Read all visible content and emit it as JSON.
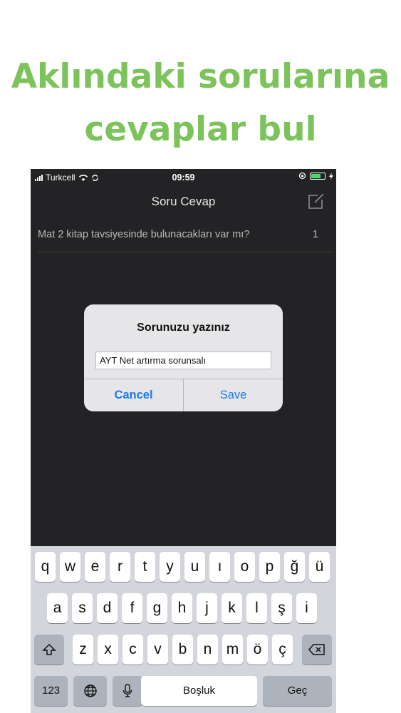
{
  "headline": {
    "line1": "Aklındaki sorularına",
    "line2": "cevaplar bul"
  },
  "status": {
    "carrier": "Turkcell",
    "time": "09:59"
  },
  "nav": {
    "title": "Soru Cevap",
    "compose_icon": "compose-icon"
  },
  "questions": [
    {
      "text": "Mat 2 kitap tavsiyesinde bulunacakları var mı?",
      "count": "1"
    }
  ],
  "dialog": {
    "title": "Sorunuzu yazınız",
    "input_value": "AYT Net artırma sorunsalı",
    "cancel": "Cancel",
    "save": "Save"
  },
  "keyboard": {
    "row1": [
      "q",
      "w",
      "e",
      "r",
      "t",
      "y",
      "u",
      "ı",
      "o",
      "p",
      "ğ",
      "ü"
    ],
    "row2": [
      "a",
      "s",
      "d",
      "f",
      "g",
      "h",
      "j",
      "k",
      "l",
      "ş",
      "i"
    ],
    "row3": [
      "z",
      "x",
      "c",
      "v",
      "b",
      "n",
      "m",
      "ö",
      "ç"
    ],
    "numbers": "123",
    "space": "Boşluk",
    "return": "Geç"
  },
  "colors": {
    "accent": "#7cc35b",
    "link": "#1b7cf2",
    "background": "#232325"
  }
}
